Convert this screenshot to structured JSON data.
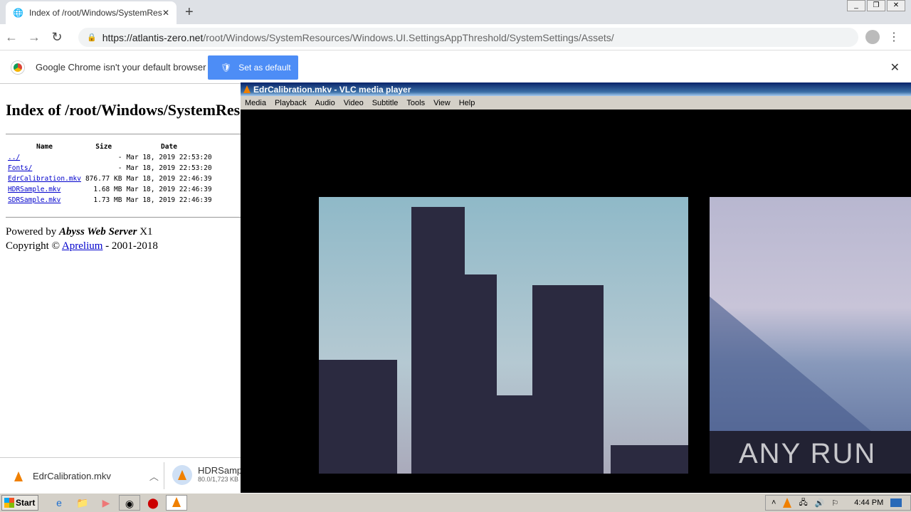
{
  "browser": {
    "tab_title": "Index of /root/Windows/SystemResources",
    "url_host": "https://atlantis-zero.net",
    "url_path": "/root/Windows/SystemResources/Windows.UI.SettingsAppThreshold/SystemSettings/Assets/"
  },
  "infobar": {
    "message": "Google Chrome isn't your default browser",
    "button": "Set as default"
  },
  "page": {
    "heading": "Index of /root/Windows/SystemResources/Windows.UI.SettingsAppThreshold/SystemSettings/Assets/",
    "columns": [
      "Name",
      "Size",
      "Date"
    ],
    "rows": [
      {
        "name": "../",
        "size": "-",
        "date": "Mar 18, 2019 22:53:20"
      },
      {
        "name": "Fonts/",
        "size": "-",
        "date": "Mar 18, 2019 22:53:20"
      },
      {
        "name": "EdrCalibration.mkv",
        "size": "876.77 KB",
        "date": "Mar 18, 2019 22:46:39"
      },
      {
        "name": "HDRSample.mkv",
        "size": "1.68 MB",
        "date": "Mar 18, 2019 22:46:39"
      },
      {
        "name": "SDRSample.mkv",
        "size": "1.73 MB",
        "date": "Mar 18, 2019 22:46:39"
      }
    ],
    "powered_prefix": "Powered by",
    "server": "Abyss Web Server",
    "server_suffix": "X1",
    "copyright_prefix": "Copyright ©",
    "copyright_link": "Aprelium",
    "copyright_suffix": "- 2001-2018"
  },
  "downloads": [
    {
      "name": "EdrCalibration.mkv"
    },
    {
      "name": "HDRSample",
      "progress": "80.0/1,723 KB"
    }
  ],
  "vlc": {
    "title": "EdrCalibration.mkv - VLC media player",
    "menu": [
      "Media",
      "Playback",
      "Audio",
      "Video",
      "Subtitle",
      "Tools",
      "View",
      "Help"
    ],
    "watermark": "ANY RUN"
  },
  "taskbar": {
    "start": "Start",
    "clock": "4:44 PM"
  }
}
